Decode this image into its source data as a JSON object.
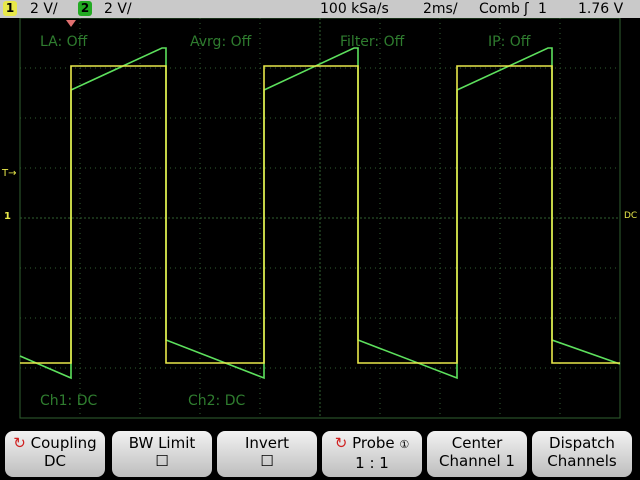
{
  "status_bar": {
    "ch1_badge": "1",
    "ch1_scale": "2 V/",
    "ch2_badge": "2",
    "ch2_scale": "2 V/",
    "sample_rate": "100 kSa/s",
    "timebase": "2ms/",
    "acquisition": "Comb",
    "trigger_source": "1",
    "trigger_level": "1.76 V"
  },
  "screen": {
    "overlays": {
      "la": "LA: Off",
      "avrg": "Avrg: Off",
      "filter": "Filter: Off",
      "ip": "IP: Off",
      "ch1": "Ch1: DC",
      "ch2": "Ch2: DC"
    },
    "markers": {
      "trigger_level": "T→",
      "ground_ch1": "1",
      "dc_label": "DC"
    }
  },
  "softkeys": [
    {
      "label": "Coupling",
      "value": "DC"
    },
    {
      "label": "BW Limit",
      "value": "☐"
    },
    {
      "label": "Invert",
      "value": "☐"
    },
    {
      "label": "Probe",
      "value": "1 : 1"
    },
    {
      "label": "Center",
      "value": "Channel 1"
    },
    {
      "label": "Dispatch",
      "value": "Channels"
    }
  ],
  "colors": {
    "ch1": "#e8e84a",
    "ch2": "#5de05d",
    "grid": "#2f5f2f",
    "status_bg": "#c9c9c9",
    "ch1_badge": "#e8e84a",
    "ch2_badge": "#22aa22"
  }
}
